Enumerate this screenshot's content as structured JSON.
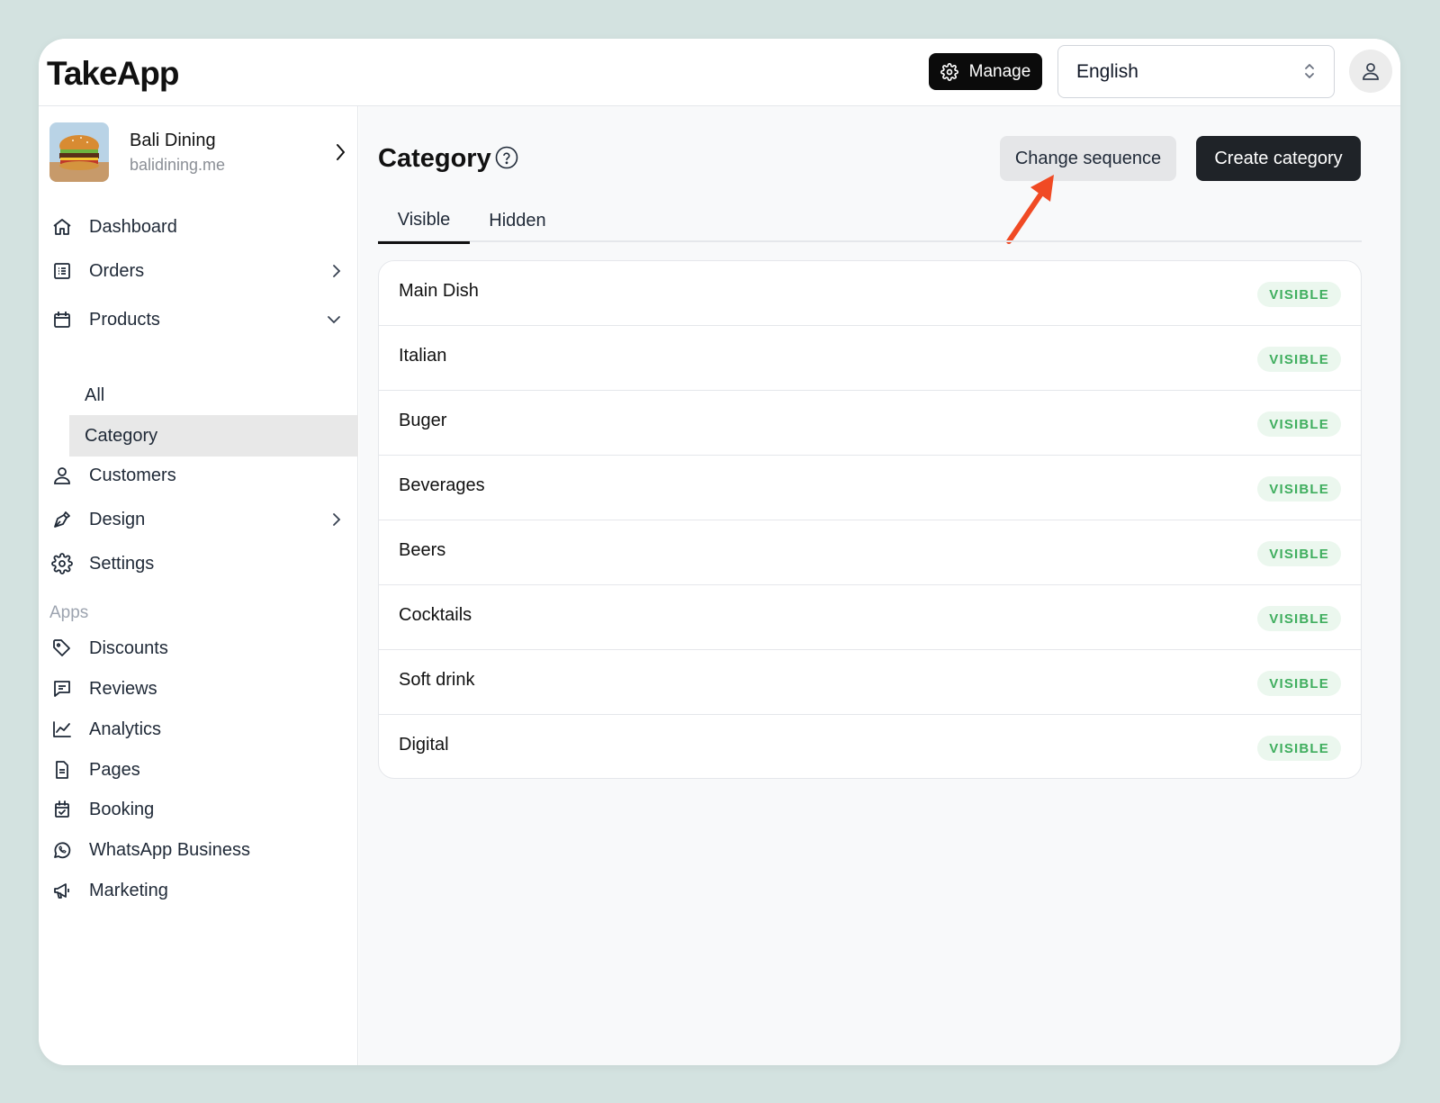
{
  "app": {
    "logo": "TakeApp"
  },
  "header": {
    "manage_label": "Manage",
    "language": "English"
  },
  "store": {
    "name": "Bali Dining",
    "url": "balidining.me"
  },
  "sidebar": {
    "items": [
      {
        "label": "Dashboard",
        "icon": "home-icon"
      },
      {
        "label": "Orders",
        "icon": "orders-icon"
      },
      {
        "label": "Products",
        "icon": "box-icon"
      },
      {
        "label": "Customers",
        "icon": "user-icon"
      },
      {
        "label": "Design",
        "icon": "pen-icon"
      },
      {
        "label": "Settings",
        "icon": "gear-icon"
      }
    ],
    "product_sub": [
      "All",
      "Category"
    ],
    "apps_label": "Apps",
    "apps": [
      {
        "label": "Discounts",
        "icon": "tag-icon"
      },
      {
        "label": "Reviews",
        "icon": "chat-icon"
      },
      {
        "label": "Analytics",
        "icon": "chart-icon"
      },
      {
        "label": "Pages",
        "icon": "file-icon"
      },
      {
        "label": "Booking",
        "icon": "calendar-icon"
      },
      {
        "label": "WhatsApp Business",
        "icon": "whatsapp-icon"
      },
      {
        "label": "Marketing",
        "icon": "megaphone-icon"
      }
    ]
  },
  "main": {
    "title": "Category",
    "change_sequence_label": "Change sequence",
    "create_label": "Create category",
    "tabs": [
      "Visible",
      "Hidden"
    ],
    "categories": [
      {
        "name": "Main Dish",
        "status": "VISIBLE"
      },
      {
        "name": "Italian",
        "status": "VISIBLE"
      },
      {
        "name": "Buger",
        "status": "VISIBLE"
      },
      {
        "name": "Beverages",
        "status": "VISIBLE"
      },
      {
        "name": "Beers",
        "status": "VISIBLE"
      },
      {
        "name": "Cocktails",
        "status": "VISIBLE"
      },
      {
        "name": "Soft drink",
        "status": "VISIBLE"
      },
      {
        "name": "Digital",
        "status": "VISIBLE"
      }
    ]
  },
  "colors": {
    "accent_dark": "#1f2328",
    "badge_bg": "#ebf7ee",
    "badge_text": "#3fae5e",
    "annotation_arrow": "#f04a24",
    "background": "#d3e2e0"
  }
}
